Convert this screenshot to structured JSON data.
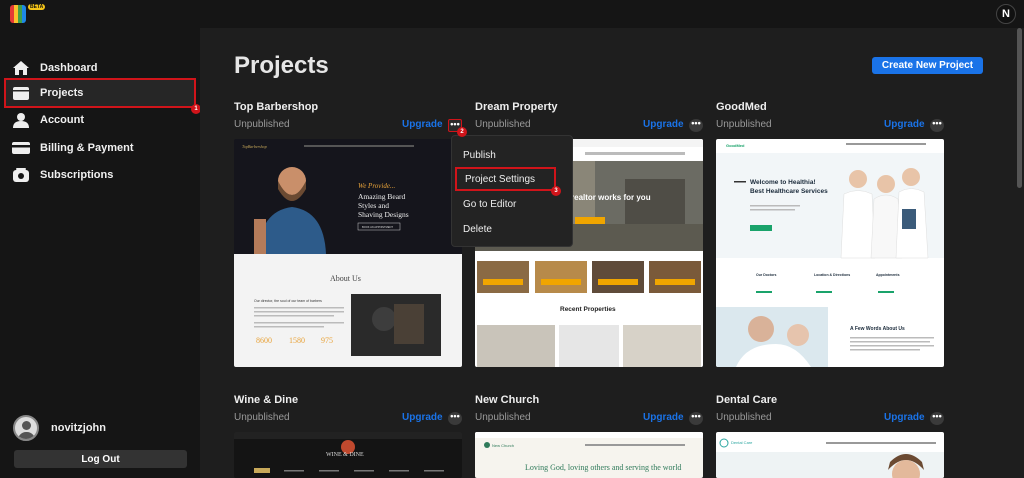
{
  "app": {
    "beta_label": "BETA",
    "profile_initial": "N"
  },
  "sidebar": {
    "items": [
      {
        "label": "Dashboard",
        "icon": "home-icon"
      },
      {
        "label": "Projects",
        "icon": "projects-icon",
        "active": true
      },
      {
        "label": "Account",
        "icon": "user-icon"
      },
      {
        "label": "Billing & Payment",
        "icon": "card-icon"
      },
      {
        "label": "Subscriptions",
        "icon": "subscriptions-icon"
      }
    ],
    "username": "novitzjohn",
    "logout_label": "Log Out"
  },
  "annotations": [
    "1",
    "2",
    "3"
  ],
  "main": {
    "title": "Projects",
    "create_button": "Create New Project",
    "upgrade_label": "Upgrade",
    "more_label": "•••",
    "projects": [
      {
        "name": "Top Barbershop",
        "status": "Unpublished",
        "preview": {
          "brand": "TopBarbershop",
          "tagline": "We Provide...",
          "headline_1": "Amazing Beard",
          "headline_2": "Styles and",
          "headline_3": "Shaving Designs",
          "cta": "BOOK AN APPOINTMENT",
          "about": "About Us",
          "about_sub": "Our director, the soul of our team of barbers",
          "stats": [
            "8600",
            "1580",
            "975"
          ]
        }
      },
      {
        "name": "Dream Property",
        "status": "Unpublished",
        "preview": {
          "hero_text": "realtor works for you",
          "section": "Recent Properties"
        }
      },
      {
        "name": "GoodMed",
        "status": "Unpublished",
        "preview": {
          "brand": "GoodMed",
          "welcome_1": "Welcome to Healthia!",
          "welcome_2": "Best Healthcare Services",
          "col_1": "Our Doctors",
          "col_2": "Location & Directions",
          "col_3": "Appointments",
          "words": "A Few Words About Us"
        }
      },
      {
        "name": "Wine & Dine",
        "status": "Unpublished",
        "preview": {
          "brand": "WINE & DINE"
        }
      },
      {
        "name": "New Church",
        "status": "Unpublished",
        "preview": {
          "brand": "New Church",
          "headline": "Loving God, loving others and serving the world"
        }
      },
      {
        "name": "Dental Care",
        "status": "Unpublished",
        "preview": {
          "brand": "Dental Care"
        }
      }
    ]
  },
  "context_menu": {
    "items": [
      "Publish",
      "Project Settings",
      "Go to Editor",
      "Delete"
    ]
  },
  "colors": {
    "accent": "#1a73e8",
    "highlight": "#d0141a"
  }
}
